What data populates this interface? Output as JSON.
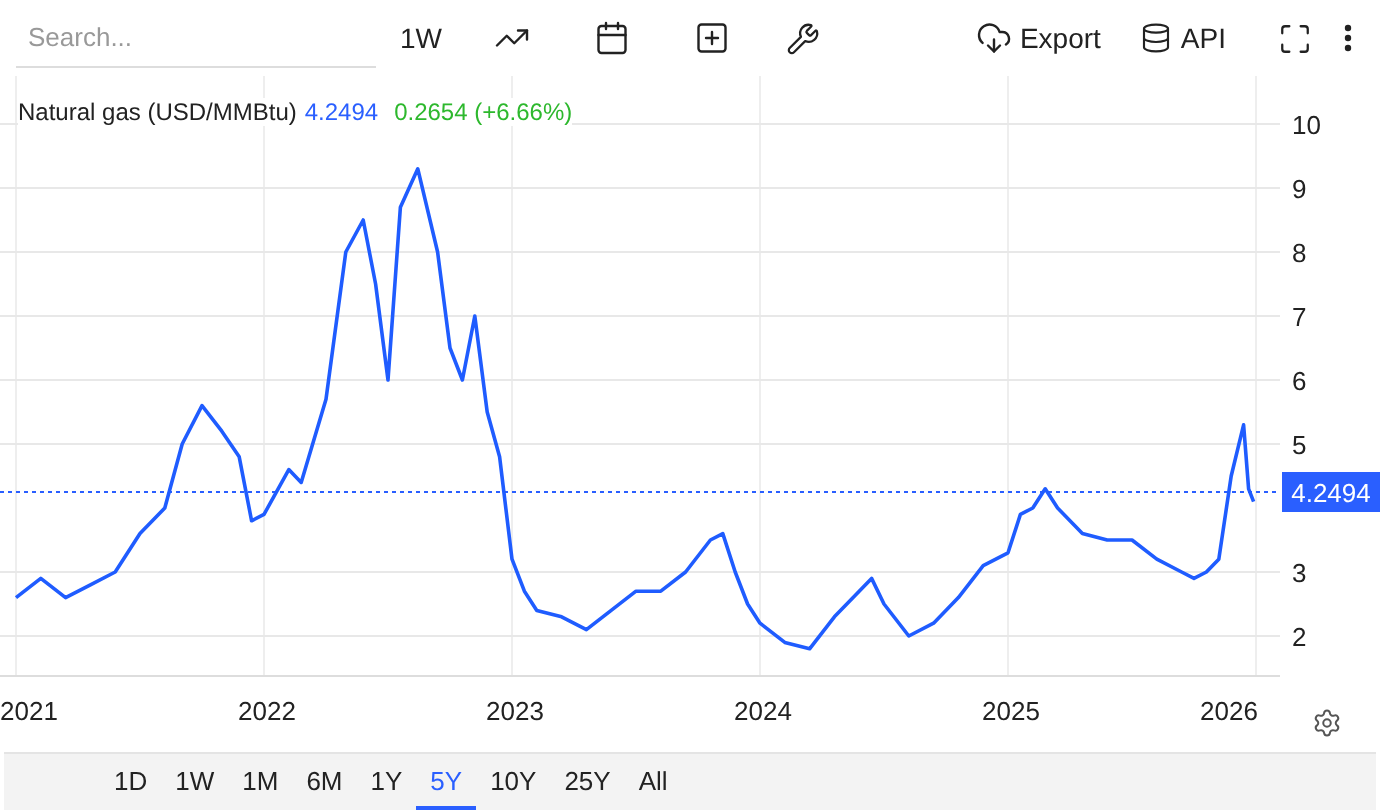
{
  "toolbar": {
    "search": {
      "placeholder": "Search..."
    },
    "interval": "1W",
    "export_label": "Export",
    "api_label": "API"
  },
  "legend": {
    "name": "Natural gas (USD/MMBtu)",
    "price": "4.2494",
    "change": "0.2654 (+6.66%)"
  },
  "chart_data": {
    "type": "line",
    "xlim": [
      2021,
      2026.02
    ],
    "ylim": [
      1.3,
      10.75
    ],
    "xticks": [
      {
        "value": 2021,
        "label": "2021"
      },
      {
        "value": 2022,
        "label": "2022"
      },
      {
        "value": 2023,
        "label": "2023"
      },
      {
        "value": 2024,
        "label": "2024"
      },
      {
        "value": 2025,
        "label": "2025"
      },
      {
        "value": 2026,
        "label": "2026"
      }
    ],
    "yticks": [
      2,
      3,
      5,
      6,
      7,
      8,
      9,
      10
    ],
    "grid": true,
    "ref_lines": [
      {
        "axis": "y",
        "value": 4.2494,
        "label": "4.2494",
        "color": "#2a5fff"
      }
    ],
    "x": [
      2021.0,
      2021.1,
      2021.2,
      2021.3,
      2021.4,
      2021.5,
      2021.6,
      2021.67,
      2021.75,
      2021.83,
      2021.9,
      2021.95,
      2022.0,
      2022.1,
      2022.15,
      2022.25,
      2022.33,
      2022.4,
      2022.45,
      2022.5,
      2022.55,
      2022.62,
      2022.7,
      2022.75,
      2022.8,
      2022.85,
      2022.9,
      2022.95,
      2023.0,
      2023.05,
      2023.1,
      2023.2,
      2023.3,
      2023.4,
      2023.5,
      2023.6,
      2023.7,
      2023.8,
      2023.85,
      2023.9,
      2023.95,
      2024.0,
      2024.1,
      2024.2,
      2024.3,
      2024.4,
      2024.45,
      2024.5,
      2024.6,
      2024.7,
      2024.8,
      2024.9,
      2025.0,
      2025.05,
      2025.1,
      2025.15,
      2025.2,
      2025.3,
      2025.4,
      2025.5,
      2025.6,
      2025.7,
      2025.75,
      2025.8,
      2025.85,
      2025.9,
      2025.95,
      2025.97,
      2025.99
    ],
    "series": [
      {
        "color": "#1f5cff",
        "values": [
          2.6,
          2.9,
          2.6,
          2.8,
          3.0,
          3.6,
          4.0,
          5.0,
          5.6,
          5.2,
          4.8,
          3.8,
          3.9,
          4.6,
          4.4,
          5.7,
          8.0,
          8.5,
          7.5,
          6.0,
          8.7,
          9.3,
          8.0,
          6.5,
          6.0,
          7.0,
          5.5,
          4.8,
          3.2,
          2.7,
          2.4,
          2.3,
          2.1,
          2.4,
          2.7,
          2.7,
          3.0,
          3.5,
          3.6,
          3.0,
          2.5,
          2.2,
          1.9,
          1.8,
          2.3,
          2.7,
          2.9,
          2.5,
          2.0,
          2.2,
          2.6,
          3.1,
          3.3,
          3.9,
          4.0,
          4.3,
          4.0,
          3.6,
          3.5,
          3.5,
          3.2,
          3.0,
          2.9,
          3.0,
          3.2,
          4.5,
          5.3,
          4.3,
          4.1
        ]
      }
    ]
  },
  "ranges": [
    {
      "label": "1D",
      "selected": false
    },
    {
      "label": "1W",
      "selected": false
    },
    {
      "label": "1M",
      "selected": false
    },
    {
      "label": "6M",
      "selected": false
    },
    {
      "label": "1Y",
      "selected": false
    },
    {
      "label": "5Y",
      "selected": true
    },
    {
      "label": "10Y",
      "selected": false
    },
    {
      "label": "25Y",
      "selected": false
    },
    {
      "label": "All",
      "selected": false
    }
  ]
}
